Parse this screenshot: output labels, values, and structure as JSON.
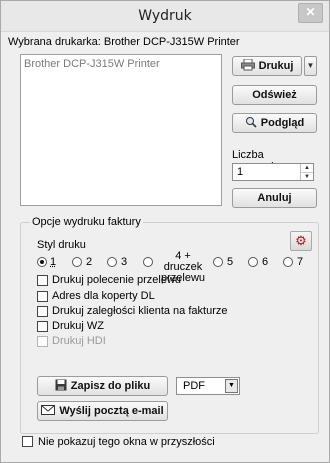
{
  "window": {
    "title": "Wydruk",
    "close_glyph": "✕"
  },
  "printer": {
    "label": "Wybrana drukarka: Brother DCP-J315W Printer",
    "list_items": [
      "Brother DCP-J315W Printer"
    ]
  },
  "buttons": {
    "print": "Drukuj",
    "refresh": "Odśwież",
    "preview": "Podgląd",
    "cancel": "Anuluj",
    "save_file": "Zapisz do pliku",
    "send_email": "Wyślij pocztą e-mail"
  },
  "copies": {
    "label": "Liczba egzemplarzy:",
    "value": "1"
  },
  "invoice_options": {
    "group_title": "Opcje wydruku faktury",
    "style_label": "Styl druku",
    "styles": [
      "1",
      "2",
      "3",
      "4 + druczek przelewu",
      "5",
      "6",
      "7"
    ],
    "selected_style": "1",
    "checkboxes": [
      {
        "label": "Drukuj polecenie przelewu",
        "checked": false,
        "enabled": true
      },
      {
        "label": "Adres dla koperty DL",
        "checked": false,
        "enabled": true
      },
      {
        "label": "Drukuj zaległości klienta na fakturze",
        "checked": false,
        "enabled": true
      },
      {
        "label": "Drukuj WZ",
        "checked": false,
        "enabled": true
      },
      {
        "label": "Drukuj HDI",
        "checked": false,
        "enabled": false
      }
    ],
    "format": {
      "selected": "PDF"
    }
  },
  "footer": {
    "dont_show_label": "Nie pokazuj tego okna w przyszłości",
    "checked": false
  },
  "icons": {
    "print": "printer-icon",
    "preview": "magnifier-icon",
    "save": "floppy-disk-icon",
    "email": "envelope-icon",
    "settings": "gear-settings-icon"
  }
}
